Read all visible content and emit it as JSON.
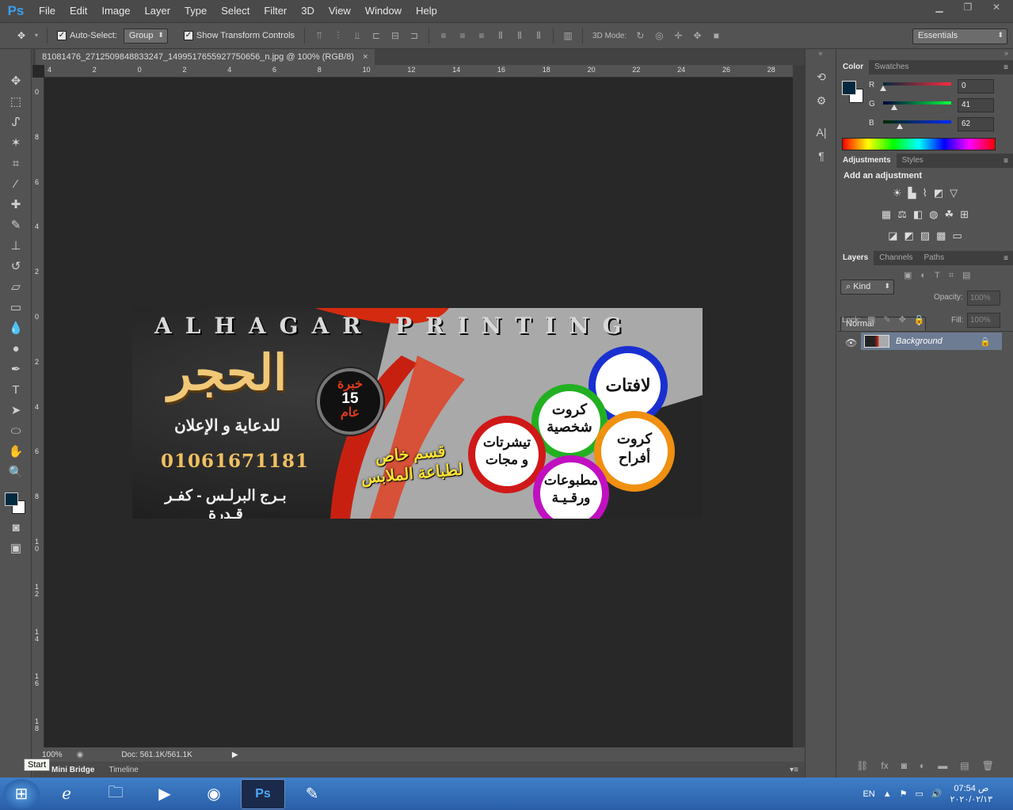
{
  "app": {
    "logo": "Ps"
  },
  "menu": [
    "File",
    "Edit",
    "Image",
    "Layer",
    "Type",
    "Select",
    "Filter",
    "3D",
    "View",
    "Window",
    "Help"
  ],
  "window_controls": {
    "minimize": "▁",
    "restore": "❐",
    "close": "✕"
  },
  "options": {
    "auto_select_label": "Auto-Select:",
    "auto_select_value": "Group",
    "show_transform_label": "Show Transform Controls",
    "mode_3d_label": "3D Mode:",
    "workspace": "Essentials"
  },
  "document": {
    "tab_title": "81081476_2712509848833247_1499517655927750656_n.jpg @ 100% (RGB/8)",
    "zoom": "100%",
    "doc_size": "Doc: 561.1K/561.1K",
    "ruler_h": [
      "4",
      "2",
      "0",
      "2",
      "4",
      "6",
      "8",
      "10",
      "12",
      "14",
      "16",
      "18",
      "20",
      "22",
      "24",
      "26",
      "28"
    ],
    "ruler_v": [
      "0",
      "8",
      "6",
      "4",
      "2",
      "0",
      "2",
      "4",
      "6",
      "8",
      "1 0",
      "1 2",
      "1 4",
      "1 6",
      "1 8"
    ]
  },
  "banner": {
    "heading_en": "ALHAGAR PRINTING",
    "name_ar": "الحجر",
    "tagline_ar": "للدعاية و الإعلان",
    "phone": "01061671181",
    "address_ar": "بـرج البرلـس - كفـر قـدرة",
    "experience_top": "خبرة",
    "experience_years": "15",
    "experience_bottom": "عام",
    "clothing_line1": "قسم خاص",
    "clothing_line2": "لطباعة الملابس",
    "circles": [
      {
        "line1": "لافتات",
        "line2": "",
        "color": "#1a2fd0"
      },
      {
        "line1": "كروت",
        "line2": "شخصية",
        "color": "#22b022"
      },
      {
        "line1": "كروت",
        "line2": "أفراح",
        "color": "#f09010"
      },
      {
        "line1": "تيشرتات",
        "line2": "و مجات",
        "color": "#d01818"
      },
      {
        "line1": "مطبوعات",
        "line2": "ورقـيـة",
        "color": "#c010c0"
      }
    ]
  },
  "bottom_tabs": [
    "Mini Bridge",
    "Timeline"
  ],
  "tooltip": "Start",
  "color_panel": {
    "tabs": [
      "Color",
      "Swatches"
    ],
    "foreground": "#00293e",
    "r_label": "R",
    "r": "0",
    "g_label": "G",
    "g": "41",
    "b_label": "B",
    "b": "62"
  },
  "adjustments_panel": {
    "tabs": [
      "Adjustments",
      "Styles"
    ],
    "title": "Add an adjustment"
  },
  "layers_panel": {
    "tabs": [
      "Layers",
      "Channels",
      "Paths"
    ],
    "kind": "Kind",
    "blend_mode": "Normal",
    "opacity_label": "Opacity:",
    "opacity": "100%",
    "lock_label": "Lock:",
    "fill_label": "Fill:",
    "fill": "100%",
    "layers": [
      {
        "name": "Background"
      }
    ]
  },
  "taskbar": {
    "lang": "EN",
    "time": "07:54 ص",
    "date": "٢٠٢٠/٠٢/١٣"
  }
}
